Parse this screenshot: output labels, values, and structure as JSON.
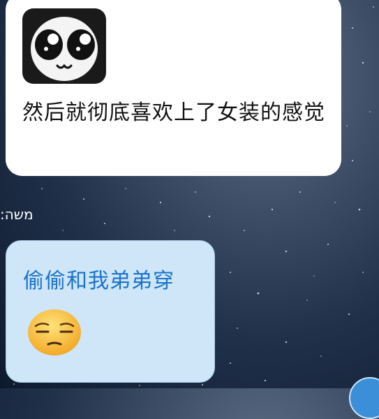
{
  "messages": [
    {
      "type": "incoming",
      "sticker": "panda-face-sticker",
      "text": "然后就彻底喜欢上了女装的感觉"
    },
    {
      "type": "incoming",
      "sender": "משה:",
      "text": "偷偷和我弟弟穿",
      "emoji": "relieved-face-emoji"
    }
  ]
}
